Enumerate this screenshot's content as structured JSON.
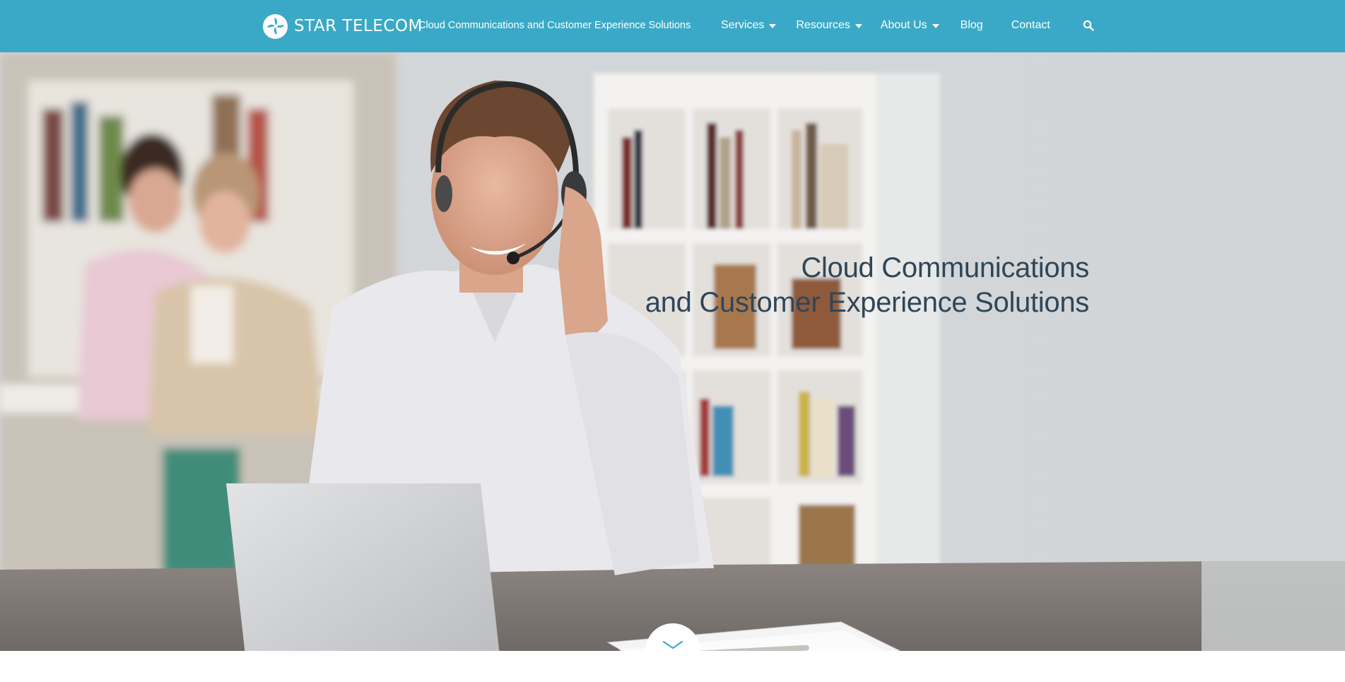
{
  "header": {
    "brand": "STAR TELECOM",
    "tagline": "Cloud Communications and Customer Experience Solutions",
    "background_color": "#3aa9c7",
    "logo_icon": "star-telecom-logo-icon",
    "nav": [
      {
        "label": "Services",
        "has_dropdown": true
      },
      {
        "label": "Resources",
        "has_dropdown": true
      },
      {
        "label": "About Us",
        "has_dropdown": true
      },
      {
        "label": "Blog",
        "has_dropdown": false
      },
      {
        "label": "Contact",
        "has_dropdown": false
      }
    ],
    "search_icon": "search-icon"
  },
  "hero": {
    "title_line1": "Cloud Communications",
    "title_line2": "and Customer Experience Solutions",
    "title_color": "#2f4658",
    "image": "man with headset smiling at laptop in office, colleagues and bookshelves in background",
    "scroll_icon": "chevron-down-icon"
  }
}
